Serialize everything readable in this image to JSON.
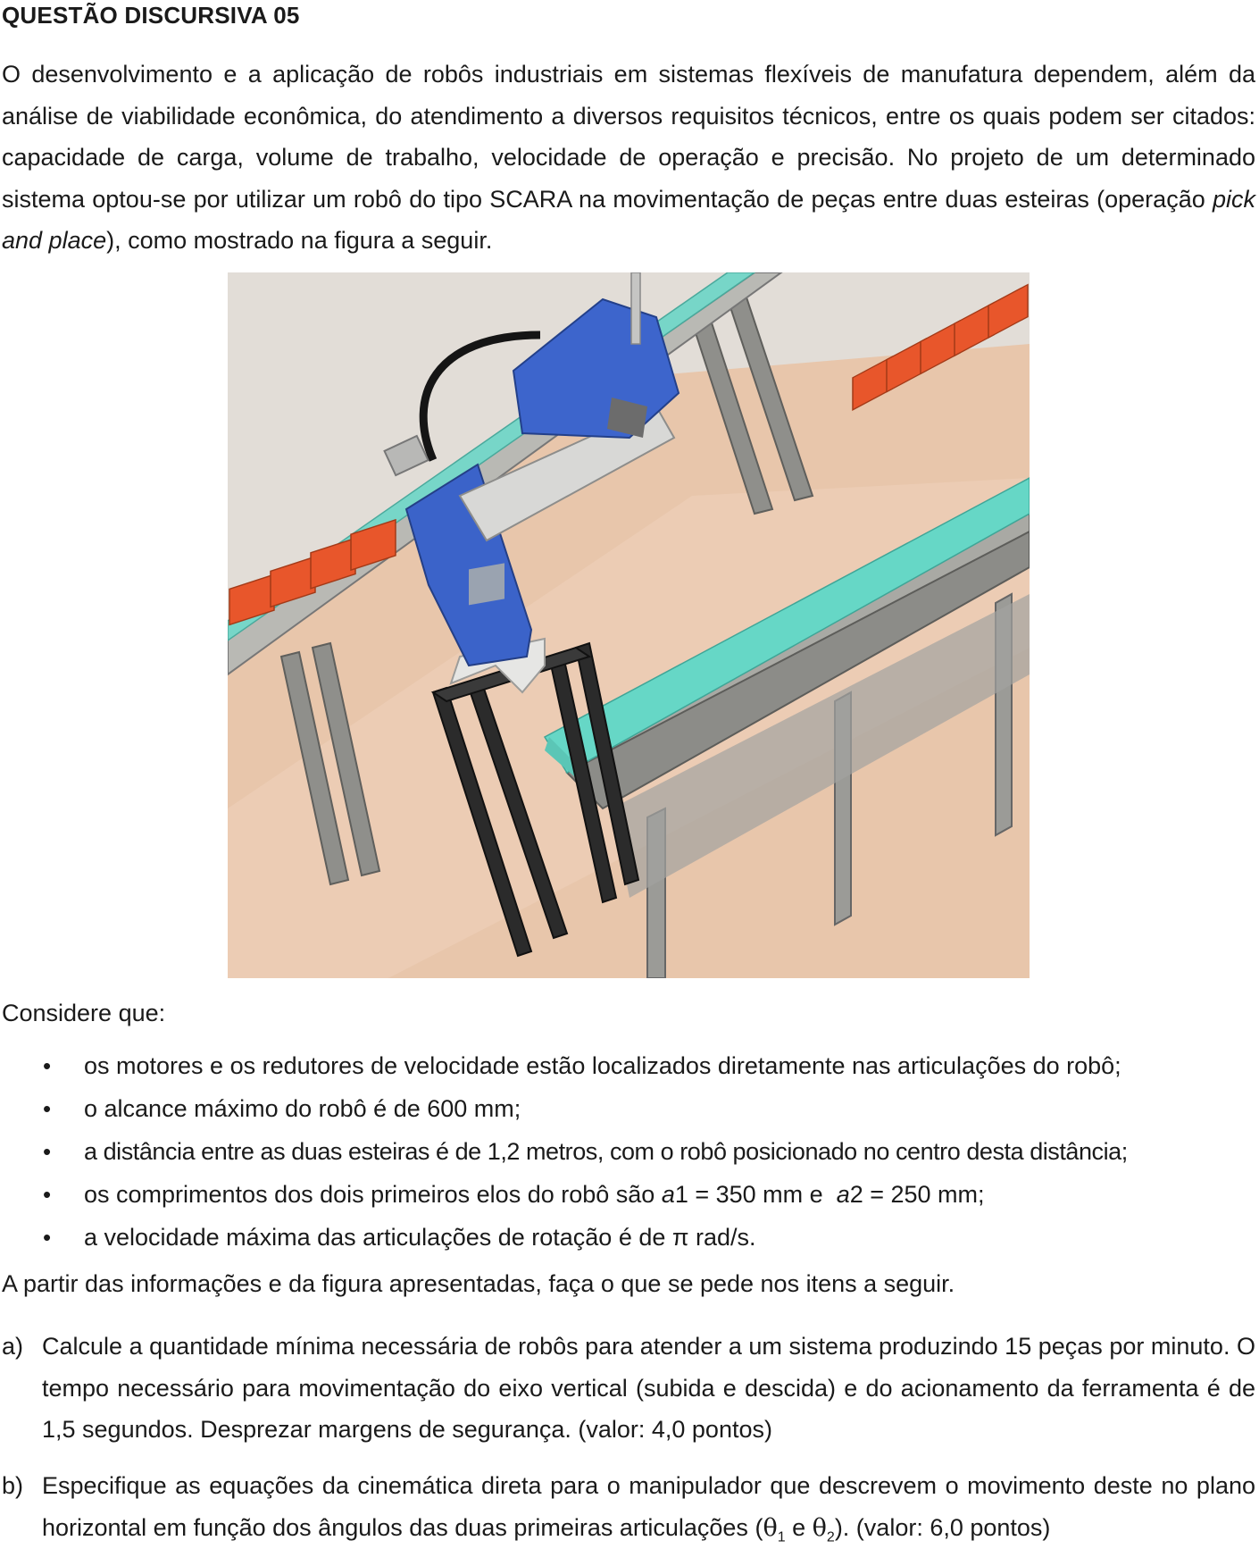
{
  "question_title": "QUESTÃO DISCURSIVA 05",
  "intro": {
    "part1": "O desenvolvimento e a aplicação de robôs industriais em sistemas flexíveis de manufatura dependem, além da análise de viabilidade econômica, do atendimento a diversos requisitos técnicos, entre os quais podem ser citados: capacidade de carga, volume de trabalho, velocidade de operação e precisão. No projeto de um determinado sistema optou-se por utilizar um robô do tipo SCARA na movimentação de peças entre duas esteiras (operação ",
    "italic": "pick and place",
    "part2": "), como mostrado na figura a seguir."
  },
  "considere_label": "Considere que:",
  "bullets": [
    "os motores e os redutores de velocidade estão localizados diretamente nas articulações do robô;",
    "o alcance máximo do robô é de 600 mm;",
    "a distância entre as duas esteiras é de 1,2 metros, com o robô posicionado no centro desta distância;",
    {
      "pre": "os comprimentos dos dois primeiros elos do robô são ",
      "var1": "a",
      "mid1": "1 = 350 mm e  ",
      "var2": "a",
      "post": "2 = 250 mm;"
    },
    "a velocidade máxima das articulações de rotação é de π rad/s."
  ],
  "instruction": "A partir das informações e da figura apresentadas, faça o que se pede nos itens a seguir.",
  "items": [
    {
      "letter": "a)",
      "text": "Calcule a quantidade mínima necessária de robôs para atender a um sistema produzindo 15 peças por minuto. O tempo necessário para movimentação do eixo vertical (subida e descida) e do acionamento da ferramenta é de 1,5 segundos. Desprezar margens de segurança. (valor: 4,0 pontos)"
    },
    {
      "letter": "b)",
      "pre": "Especifique as equações da cinemática direta para o manipulador que descrevem o movimento deste no plano horizontal em função dos ângulos das duas primeiras articulações (",
      "theta": "θ",
      "sub1": "1",
      "and": " e ",
      "sub2": "2",
      "post": "). (valor: 6,0 pontos)"
    }
  ],
  "colors": {
    "robot_blue": "#3a5fc4",
    "conveyor_teal": "#5fd1c2",
    "part_orange": "#e8552a",
    "floor": "#e6c3a8",
    "frame_gray": "#9a9a96"
  }
}
